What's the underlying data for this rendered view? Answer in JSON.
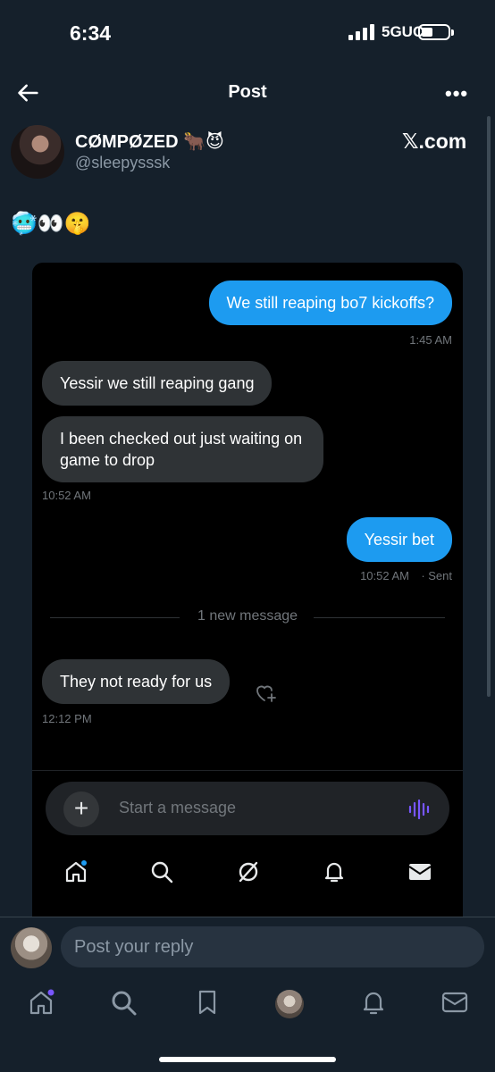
{
  "status_bar": {
    "time": "6:34",
    "network": "5GUC"
  },
  "header": {
    "title": "Post"
  },
  "author": {
    "display_name": "CØMPØZED 🐂😈",
    "handle": "@sleepysssk",
    "watermark": "𝕏.com"
  },
  "post": {
    "text": "🥶👀🤫"
  },
  "dm": {
    "messages": [
      {
        "direction": "out",
        "text": "We still reaping bo7 kickoffs?",
        "time": "1:45 AM"
      },
      {
        "direction": "in",
        "text": "Yessir we still reaping gang"
      },
      {
        "direction": "in",
        "text": "I been checked out just waiting on game to drop",
        "time": "10:52 AM"
      },
      {
        "direction": "out",
        "text": "Yessir bet",
        "time": "10:52 AM",
        "status": "· Sent"
      },
      {
        "direction": "in",
        "text": "They not ready for us",
        "time": "12:12 PM"
      }
    ],
    "new_message_divider": "1 new message",
    "composer_placeholder": "Start a message",
    "nav": [
      "home-icon",
      "search-icon",
      "grok-icon",
      "notifications-icon",
      "messages-icon"
    ]
  },
  "reply": {
    "placeholder": "Post your reply"
  },
  "bottom_nav": [
    "home-icon",
    "search-icon",
    "bookmark-icon",
    "communities-avatar",
    "notifications-icon",
    "mail-icon"
  ],
  "colors": {
    "background": "#15202b",
    "accent": "#1d9bf0",
    "incoming_bubble": "#2f3336",
    "voice_icon": "#7856ff"
  }
}
